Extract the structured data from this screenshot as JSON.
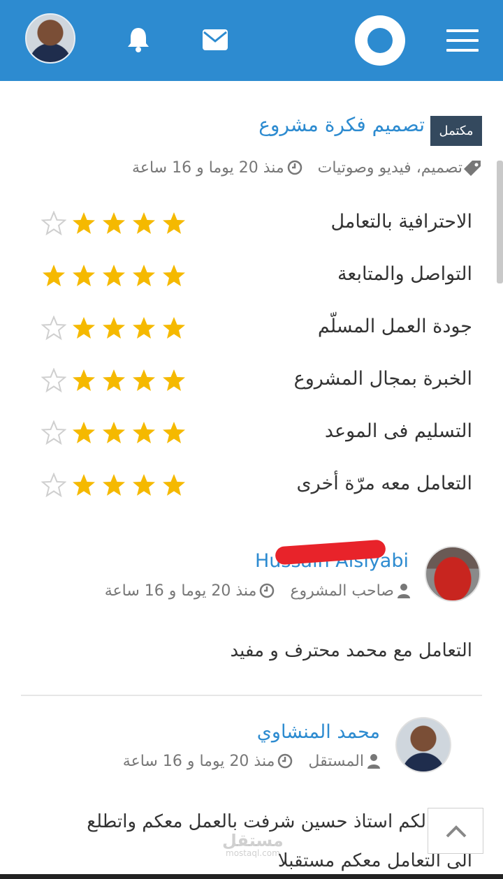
{
  "header": {
    "brand_color": "#2d8bd0",
    "icons": [
      "user-avatar",
      "bell-icon",
      "envelope-icon",
      "logo-circle",
      "hamburger-menu-icon"
    ]
  },
  "project": {
    "status": "مكتمل",
    "title": "تصميم فكرة مشروع",
    "category": "تصميم، فيديو وصوتيات",
    "time": "منذ 20 يوما و 16 ساعة"
  },
  "ratings": [
    {
      "label": "الاحترافية بالتعامل",
      "stars": 4
    },
    {
      "label": "التواصل والمتابعة",
      "stars": 5
    },
    {
      "label": "جودة العمل المسلّم",
      "stars": 4
    },
    {
      "label": "الخبرة بمجال المشروع",
      "stars": 4
    },
    {
      "label": "التسليم فى الموعد",
      "stars": 4
    },
    {
      "label": "التعامل معه مرّة أخرى",
      "stars": 4
    }
  ],
  "comments": [
    {
      "name": "Hussain Alsiyabi",
      "role": "صاحب المشروع",
      "time": "منذ 20 يوما و 16 ساعة",
      "text": "التعامل مع محمد محترف و مفيد"
    },
    {
      "name": "محمد المنشاوي",
      "role": "المستقل",
      "time": "منذ 20 يوما و 16 ساعة",
      "text_line1": "شكرا لكم استاذ حسين شرفت بالعمل معكم واتطلع",
      "text_line2": "الى التعامل معكم مستقبلا"
    }
  ],
  "watermark": {
    "main": "مستقل",
    "sub": "mostaql.com"
  },
  "colors": {
    "star_filled": "#f5b900",
    "star_empty": "#cfcfcf",
    "badge": "#34495e"
  }
}
